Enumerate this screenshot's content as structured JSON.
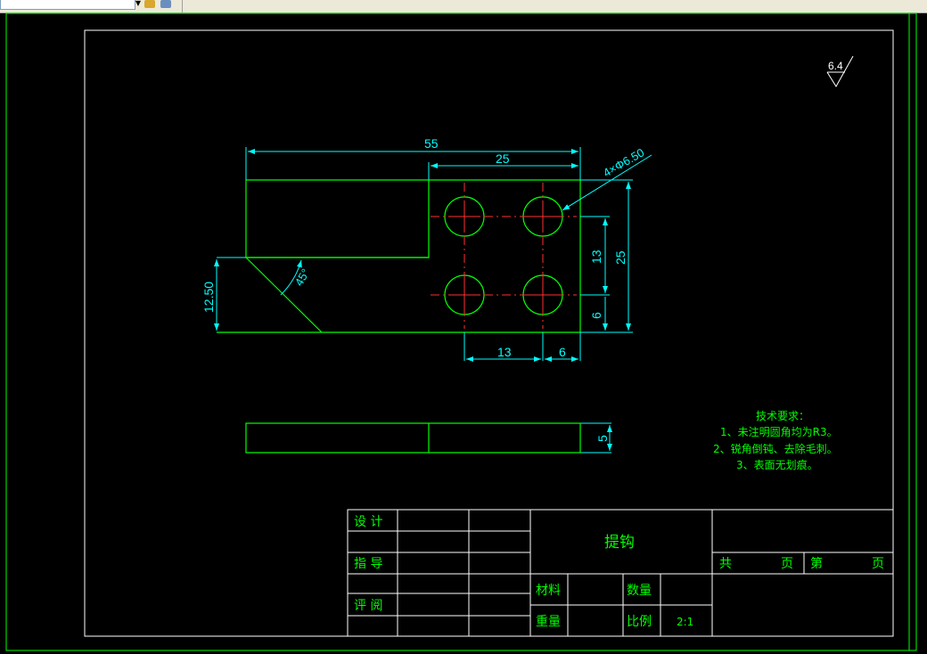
{
  "window": {
    "title": ""
  },
  "colors": {
    "frame": "#00ff00",
    "part": "#00ff00",
    "dimension": "#00ffff",
    "center": "#ff3030",
    "text": "#00ff00",
    "background": "#000000"
  },
  "toolbar": {
    "dropdown_icon": "chevron-down-icon",
    "tool1_icon": "layer-icon",
    "tool2_icon": "layer-state-icon"
  },
  "drawing": {
    "surface_finish": "6.4",
    "dims": {
      "overall_width": "55",
      "upper_width": "25",
      "holes": "4×Φ6.50",
      "chamfer_angle": "45°",
      "left_height": "12.50",
      "hole_pitch_v": "13",
      "right_height": "25",
      "edge_v": "6",
      "hole_pitch_h": "13",
      "edge_h": "6",
      "thickness": "5"
    },
    "notes": {
      "title": "技术要求：",
      "lines": [
        "1、未注明圆角均为R3。",
        "2、锐角倒钝、去除毛刺。",
        "3、表面无划痕。"
      ]
    }
  },
  "title_block": {
    "design": "设 计",
    "guide": "指 导",
    "review": "评 阅",
    "part_name": "提钩",
    "total": "共",
    "page": "页",
    "page_no": "第",
    "page2": "页",
    "material": "材料",
    "quantity": "数量",
    "weight": "重量",
    "scale_label": "比例",
    "scale": "2:1"
  }
}
